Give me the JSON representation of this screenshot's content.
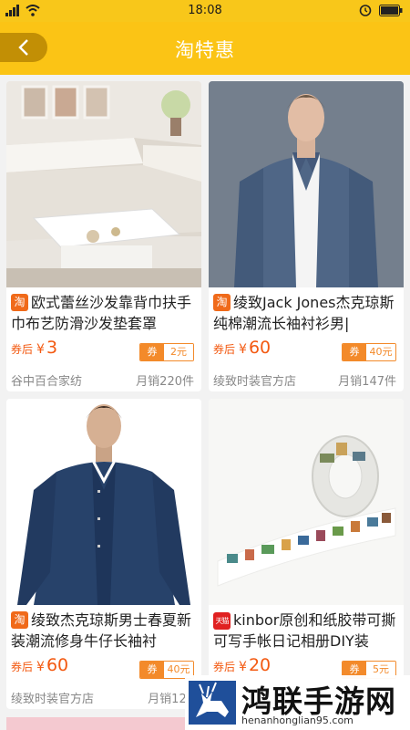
{
  "status_bar": {
    "time": "18:08"
  },
  "header": {
    "title": "淘特惠"
  },
  "products": [
    {
      "badge": "淘",
      "title": "欧式蕾丝沙发靠背巾扶手巾布艺防滑沙发垫套罩",
      "price_label": "券后",
      "currency": "¥",
      "price": "3",
      "coupon_label": "券",
      "coupon_amount": "2元",
      "shop": "谷中百合家纺",
      "sales": "月销220件"
    },
    {
      "badge": "淘",
      "title": "绫致Jack Jones杰克琼斯纯棉潮流长袖衬衫男|",
      "price_label": "券后",
      "currency": "¥",
      "price": "60",
      "coupon_label": "券",
      "coupon_amount": "40元",
      "shop": "绫致时装官方店",
      "sales": "月销147件"
    },
    {
      "badge": "淘",
      "title": "绫致杰克琼斯男士春夏新装潮流修身牛仔长袖衬",
      "price_label": "券后",
      "currency": "¥",
      "price": "60",
      "coupon_label": "券",
      "coupon_amount": "40元",
      "shop": "绫致时装官方店",
      "sales": "月销124"
    },
    {
      "badge": "天猫",
      "title": "kinbor原创和纸胶带可撕可写手帐日记相册DIY装",
      "price_label": "券后",
      "currency": "¥",
      "price": "20",
      "coupon_label": "券",
      "coupon_amount": "5元",
      "shop": "",
      "sales": ""
    }
  ],
  "watermark": {
    "title": "鸿联手游网",
    "url": "henanhonglian95.com"
  },
  "colors": {
    "header": "#fbc415",
    "accent": "#f35a12",
    "coupon": "#f38a2a"
  }
}
